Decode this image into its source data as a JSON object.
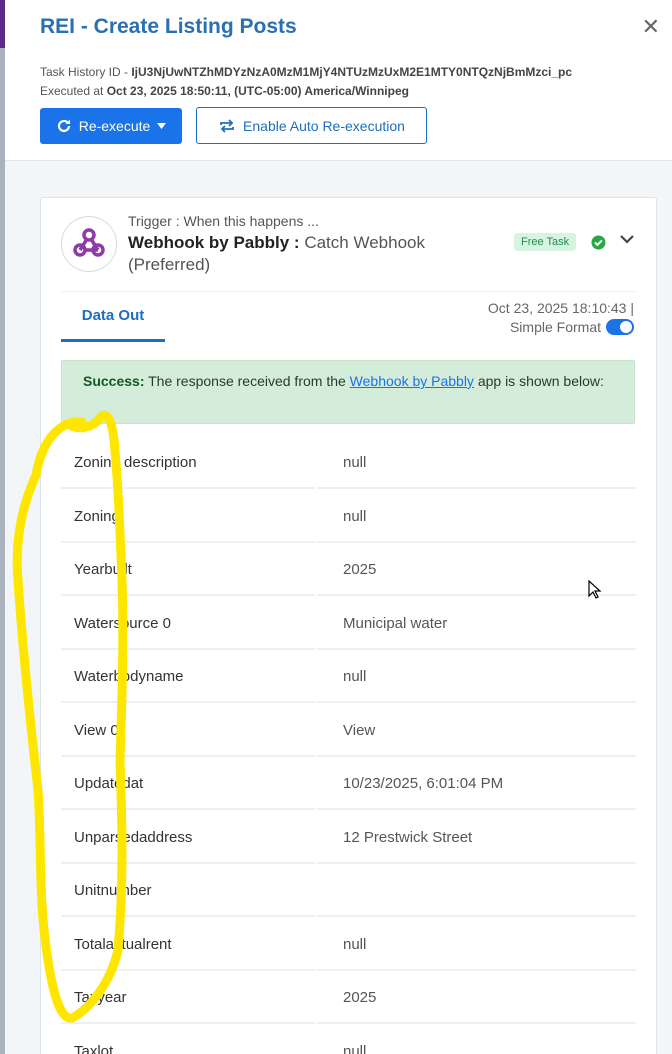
{
  "header": {
    "title": "REI - Create Listing Posts",
    "task_history_label": "Task History ID - ",
    "task_history_id": "IjU3NjUwNTZhMDYzNzA0MzM1MjY4NTUzMzUxM2E1MTY0NTQzNjBmMzci_pc",
    "executed_label": "Executed at ",
    "executed_value": "Oct 23, 2025 18:50:11, (UTC-05:00) America/Winnipeg",
    "reexecute_label": "Re-execute",
    "auto_reexecution_label": "Enable Auto Re-execution"
  },
  "step": {
    "trigger_label": "Trigger : When this happens ...",
    "app_name": "Webhook by Pabbly : ",
    "action_name": "Catch Webhook (Preferred)",
    "badge": "Free Task",
    "tab_label": "Data Out",
    "timestamp": "Oct 23, 2025 18:10:43  |",
    "format_label": "Simple Format",
    "alert": {
      "prefix": "Success:",
      "text_before": " The response received from the ",
      "link": "Webhook by Pabbly",
      "text_after": " app is shown below:"
    },
    "rows": [
      {
        "key": "Zoning description",
        "value": "null"
      },
      {
        "key": "Zoning",
        "value": "null"
      },
      {
        "key": "Yearbuilt",
        "value": "2025"
      },
      {
        "key": "Watersource 0",
        "value": "Municipal water"
      },
      {
        "key": "Waterbodyname",
        "value": "null"
      },
      {
        "key": "View 0",
        "value": "View"
      },
      {
        "key": "Updatedat",
        "value": "10/23/2025, 6:01:04 PM"
      },
      {
        "key": "Unparsedaddress",
        "value": "12 Prestwick Street"
      },
      {
        "key": "Unitnumber",
        "value": ""
      },
      {
        "key": "Totalactualrent",
        "value": "null"
      },
      {
        "key": "Taxyear",
        "value": "2025"
      },
      {
        "key": "Taxlot",
        "value": "null"
      }
    ]
  },
  "colors": {
    "accent": "#1a73e8",
    "title": "#2a6fb0",
    "success_bg": "#d4edda",
    "badge_bg": "#d7f4e1",
    "annotation": "#ffe600"
  },
  "icons": [
    "close-icon",
    "redo-icon",
    "caret-down-icon",
    "repeat-icon",
    "webhook-app-icon",
    "check-circle-icon",
    "chevron-down-icon",
    "mouse-cursor-icon"
  ]
}
